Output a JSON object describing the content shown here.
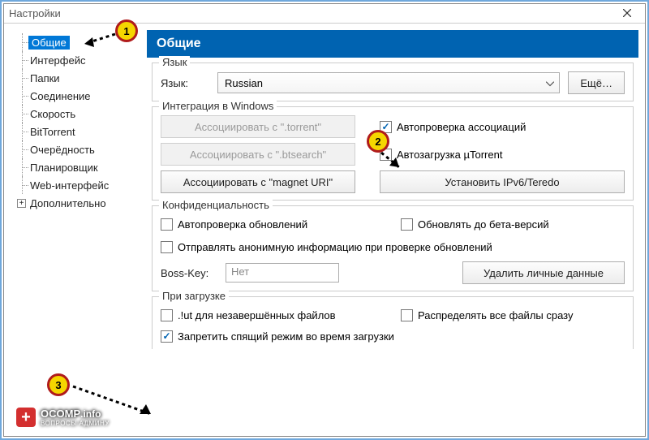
{
  "window": {
    "title": "Настройки"
  },
  "tree": {
    "items": [
      "Общие",
      "Интерфейс",
      "Папки",
      "Соединение",
      "Скорость",
      "BitTorrent",
      "Очерёдность",
      "Планировщик",
      "Web-интерфейс",
      "Дополнительно"
    ]
  },
  "panel": {
    "title": "Общие"
  },
  "lang_group": {
    "legend": "Язык",
    "label": "Язык:",
    "value": "Russian",
    "more_btn": "Ещё…"
  },
  "integration_group": {
    "legend": "Интеграция в Windows",
    "assoc_torrent_btn": "Ассоциировать с \".torrent\"",
    "assoc_btsearch_btn": "Ассоциировать с \".btsearch\"",
    "assoc_magnet_btn": "Ассоциировать с \"magnet URI\"",
    "autocheck_assoc": "Автопроверка ассоциаций",
    "autoload_utorrent": "Автозагрузка µTorrent",
    "install_ipv6_btn": "Установить IPv6/Teredo"
  },
  "privacy_group": {
    "legend": "Конфиденциальность",
    "autocheck_updates": "Автопроверка обновлений",
    "update_beta": "Обновлять до бета-версий",
    "send_anon": "Отправлять анонимную информацию при проверке обновлений",
    "bosskey_label": "Boss-Key:",
    "bosskey_value": "Нет",
    "delete_data_btn": "Удалить личные данные"
  },
  "download_group": {
    "legend": "При загрузке",
    "ut_incomplete": ".!ut для незавершённых файлов",
    "prealloc": "Распределять все файлы сразу",
    "prevent_sleep": "Запретить спящий режим во время загрузки"
  },
  "annotations": {
    "b1": "1",
    "b2": "2",
    "b3": "3"
  },
  "watermark": {
    "main": "OCOMP",
    "suffix": ".info",
    "sub": "ВОПРОСЫ АДМИНУ"
  }
}
